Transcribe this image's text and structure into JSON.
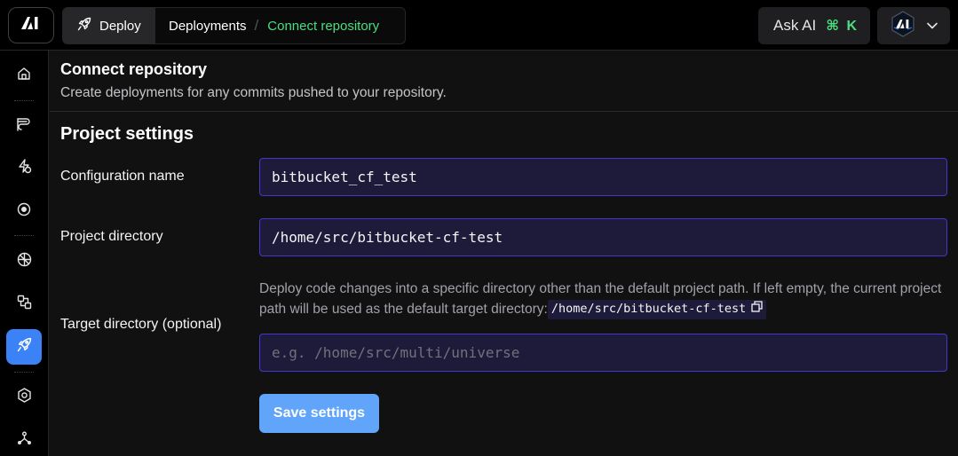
{
  "topbar": {
    "logo_icon": "brand-logo-icon",
    "breadcrumb": {
      "deploy_icon": "rocket-icon",
      "deploy_label": "Deploy",
      "deployments_label": "Deployments",
      "separator": "/",
      "current_label": "Connect repository"
    },
    "ask_ai": {
      "label": "Ask AI",
      "shortcut": "⌘ K"
    },
    "profile": {
      "avatar_icon": "brand-avatar-icon",
      "chevron_icon": "chevron-down-icon"
    }
  },
  "sidebar": {
    "items": [
      {
        "name": "home",
        "icon": "home-icon",
        "active": false
      },
      {
        "name": "pipelines",
        "icon": "pipeline-icon",
        "active": false
      },
      {
        "name": "performance",
        "icon": "bolt-icon",
        "active": false
      },
      {
        "name": "monitoring",
        "icon": "target-icon",
        "active": false
      },
      {
        "name": "network",
        "icon": "network-icon",
        "active": false
      },
      {
        "name": "workflows",
        "icon": "workflow-icon",
        "active": false
      },
      {
        "name": "deploy",
        "icon": "rocket-icon",
        "active": true
      },
      {
        "name": "settings",
        "icon": "hexagon-gear-icon",
        "active": false
      },
      {
        "name": "integrations",
        "icon": "tripod-icon",
        "active": false
      }
    ]
  },
  "header": {
    "title": "Connect repository",
    "subtitle": "Create deployments for any commits pushed to your repository."
  },
  "project_settings": {
    "title": "Project settings",
    "configuration_name": {
      "label": "Configuration name",
      "value": "bitbucket_cf_test"
    },
    "project_directory": {
      "label": "Project directory",
      "value": "/home/src/bitbucket-cf-test"
    },
    "target_directory": {
      "label": "Target directory (optional)",
      "help_text": "Deploy code changes into a specific directory other than the default project path. If left empty, the current project path will be used as the default target directory:",
      "default_path": "/home/src/bitbucket-cf-test",
      "copy_icon": "copy-icon",
      "placeholder": "e.g. /home/src/multi/universe",
      "value": ""
    },
    "save_label": "Save settings"
  },
  "colors": {
    "accent": "#3b82f6",
    "save_button": "#60a5fa",
    "breadcrumb_current": "#4ade80",
    "input_bg": "#1e1b3a",
    "input_border": "#4338ca"
  }
}
